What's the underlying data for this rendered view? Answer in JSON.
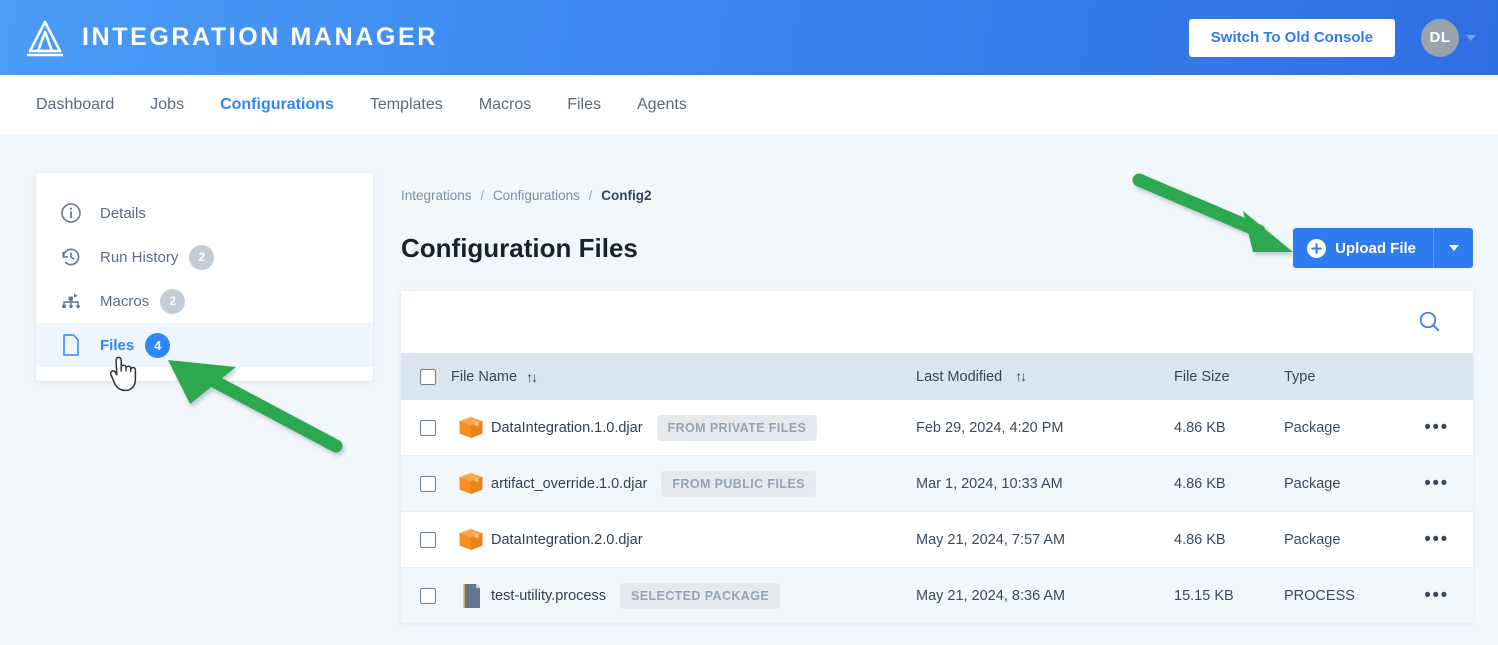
{
  "app": {
    "brand_name": "INTEGRATION MANAGER",
    "logo_icon": "mountain-logo-icon",
    "switch_console_label": "Switch To Old Console",
    "avatar_initials": "DL",
    "avatar_caret_icon": "chevron-down-icon"
  },
  "nav": {
    "items": [
      {
        "label": "Dashboard",
        "active": false
      },
      {
        "label": "Jobs",
        "active": false
      },
      {
        "label": "Configurations",
        "active": true
      },
      {
        "label": "Templates",
        "active": false
      },
      {
        "label": "Macros",
        "active": false
      },
      {
        "label": "Files",
        "active": false
      },
      {
        "label": "Agents",
        "active": false
      }
    ]
  },
  "sidebar": {
    "items": [
      {
        "label": "Details",
        "icon": "info-circle-icon",
        "badge": "",
        "active": false
      },
      {
        "label": "Run History",
        "icon": "history-clock-icon",
        "badge": "2",
        "active": false
      },
      {
        "label": "Macros",
        "icon": "macro-hierarchy-icon",
        "badge": "2",
        "active": false
      },
      {
        "label": "Files",
        "icon": "file-page-icon",
        "badge": "4",
        "active": true
      }
    ]
  },
  "breadcrumb": {
    "items": [
      "Integrations",
      "Configurations"
    ],
    "separator": "/",
    "current": "Config2"
  },
  "main": {
    "title": "Configuration Files",
    "upload_label": "Upload File",
    "upload_plus_icon": "plus-circle-icon",
    "upload_caret_icon": "chevron-down-icon",
    "search_icon": "search-icon"
  },
  "table": {
    "columns": [
      {
        "key": "checkbox",
        "label": ""
      },
      {
        "key": "name",
        "label": "File Name",
        "sortable": true,
        "sort_icon": "sort-updown-icon"
      },
      {
        "key": "modified",
        "label": "Last Modified",
        "sortable": true,
        "sort_icon": "sort-updown-icon"
      },
      {
        "key": "size",
        "label": "File Size",
        "sortable": false
      },
      {
        "key": "type",
        "label": "Type",
        "sortable": false
      },
      {
        "key": "menu",
        "label": ""
      }
    ],
    "rows": [
      {
        "name": "DataIntegration.1.0.djar",
        "pill": "FROM PRIVATE FILES",
        "icon": "package-box-icon",
        "modified": "Feb 29, 2024, 4:20 PM",
        "size": "4.86 KB",
        "type": "Package",
        "menu_icon": "more-options-icon",
        "checked": false
      },
      {
        "name": "artifact_override.1.0.djar",
        "pill": "FROM PUBLIC FILES",
        "icon": "package-box-icon",
        "modified": "Mar 1, 2024, 10:33 AM",
        "size": "4.86 KB",
        "type": "Package",
        "menu_icon": "more-options-icon",
        "checked": false
      },
      {
        "name": "DataIntegration.2.0.djar",
        "pill": "",
        "icon": "package-box-icon",
        "modified": "May 21, 2024, 7:57 AM",
        "size": "4.86 KB",
        "type": "Package",
        "menu_icon": "more-options-icon",
        "checked": false
      },
      {
        "name": "test-utility.process",
        "pill": "SELECTED PACKAGE",
        "icon": "process-document-icon",
        "modified": "May 21, 2024, 8:36 AM",
        "size": "15.15 KB",
        "type": "PROCESS",
        "menu_icon": "more-options-icon",
        "checked": false
      }
    ]
  },
  "annotations": {
    "arrow_color": "#2fa84f",
    "arrows": [
      {
        "name": "arrow-to-upload-file",
        "points_to": "Upload File"
      },
      {
        "name": "arrow-to-files-tab",
        "points_to": "Files"
      }
    ],
    "cursor": "hand-pointer-cursor"
  },
  "colors": {
    "brand_blue": "#2f7bf0",
    "accent_blue": "#2f87f7",
    "header_row": "#dbe5f0",
    "package_orange": "#f7901e",
    "badge_gray": "#c3ccd6",
    "arrow_green": "#2fa84f"
  }
}
